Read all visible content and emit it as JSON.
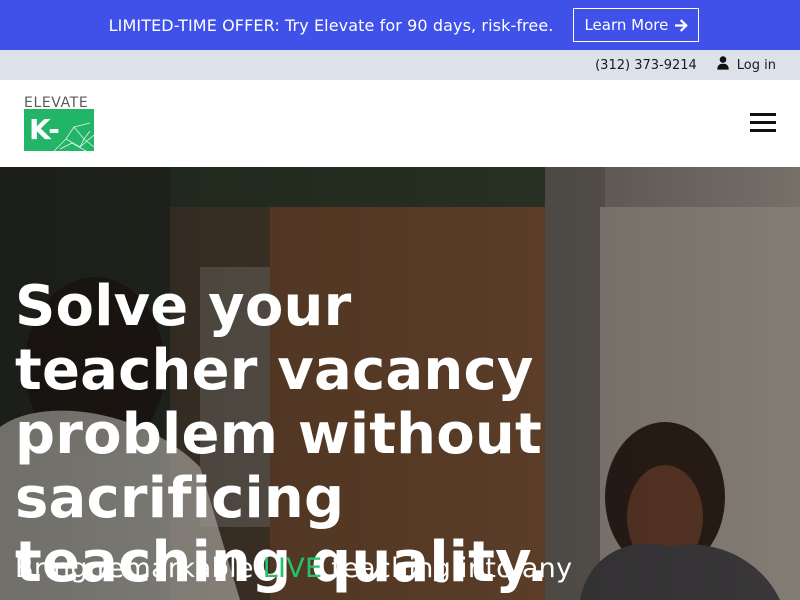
{
  "promo": {
    "text": "LIMITED-TIME OFFER: Try Elevate for 90 days, risk-free.",
    "button_label": "Learn More"
  },
  "utility": {
    "phone": "(312) 373-9214",
    "login_label": "Log in"
  },
  "logo": {
    "word": "ELEVATE",
    "mark": "K-12"
  },
  "hero": {
    "headline": "Solve your teacher vacancy problem without sacrificing teaching quality.",
    "subhead_before": "Bring remarkable ",
    "subhead_highlight": "LIVE",
    "subhead_after": " teaching into any"
  },
  "colors": {
    "promo_bg": "#3f51e8",
    "utility_bg": "#dde1ea",
    "brand_green": "#23b567"
  },
  "icons": {
    "promo_arrow": "arrow-right-icon",
    "login": "user-icon",
    "menu": "hamburger-menu-icon"
  }
}
